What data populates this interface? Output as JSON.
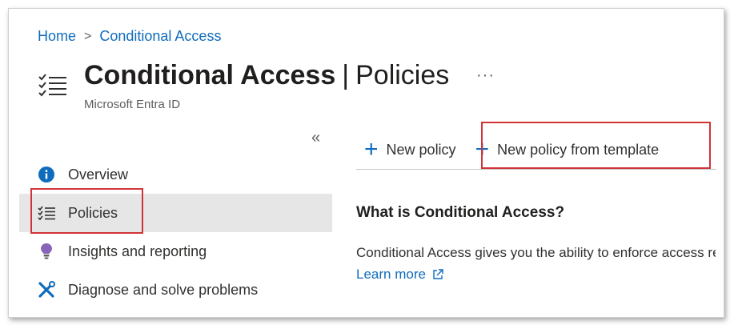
{
  "breadcrumb": {
    "home": "Home",
    "separator": ">",
    "current": "Conditional Access"
  },
  "header": {
    "title_main": "Conditional Access",
    "title_separator": "|",
    "title_section": "Policies",
    "subtitle": "Microsoft Entra ID",
    "more": "···",
    "icon": "policy-list-icon"
  },
  "sidebar": {
    "collapse_label": "«",
    "items": [
      {
        "label": "Overview",
        "icon": "info-icon"
      },
      {
        "label": "Policies",
        "icon": "policy-list-icon",
        "selected": true
      },
      {
        "label": "Insights and reporting",
        "icon": "lightbulb-icon"
      },
      {
        "label": "Diagnose and solve problems",
        "icon": "wrench-icon"
      }
    ]
  },
  "toolbar": {
    "new_policy": "New policy",
    "new_policy_from_template": "New policy from template",
    "plus": "+"
  },
  "content": {
    "section_title": "What is Conditional Access?",
    "description": "Conditional Access gives you the ability to enforce access requirements when specific conditions occur.",
    "learn_more": "Learn more"
  },
  "colors": {
    "accent": "#0f6cbd",
    "highlight": "#d13438",
    "selected_bg": "#e6e6e6"
  }
}
